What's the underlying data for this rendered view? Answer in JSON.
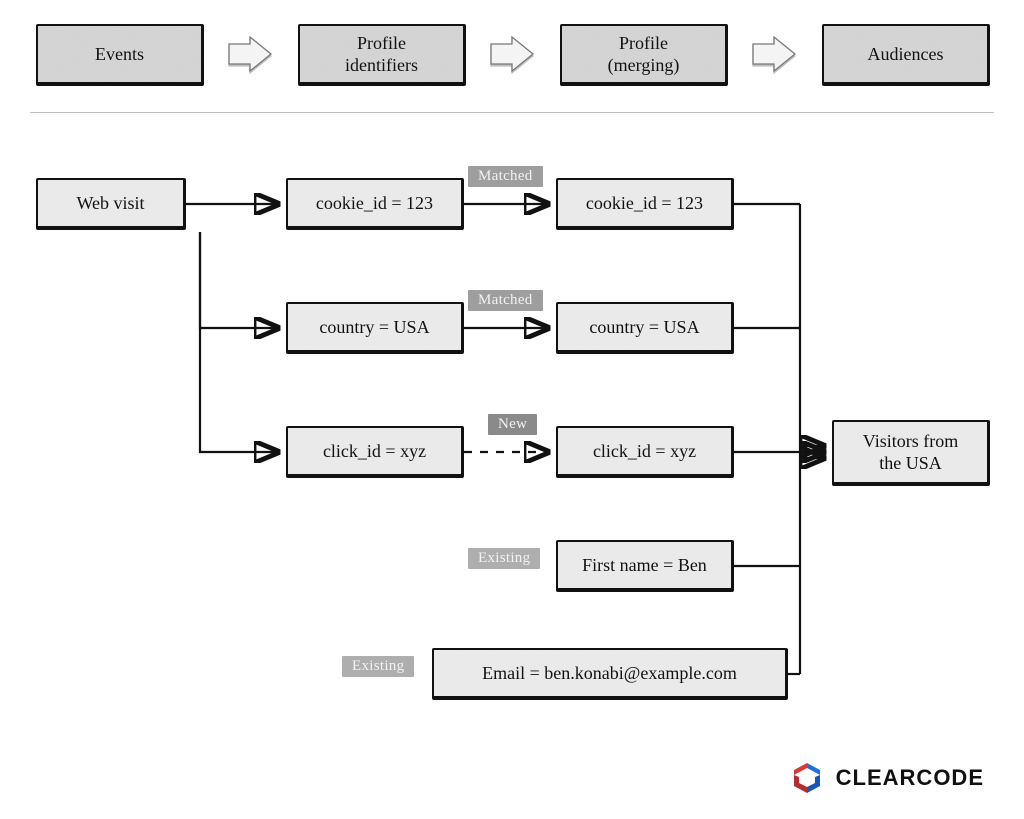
{
  "header": {
    "events": "Events",
    "identifiers": "Profile\nidentifiers",
    "merging": "Profile\n(merging)",
    "audiences": "Audiences"
  },
  "events": {
    "web_visit": "Web visit"
  },
  "identifiers": {
    "cookie": "cookie_id = 123",
    "country": "country = USA",
    "click": "click_id = xyz"
  },
  "merging": {
    "cookie": "cookie_id = 123",
    "country": "country = USA",
    "click": "click_id = xyz",
    "first_name": "First name = Ben",
    "email": "Email = ben.konabi@example.com"
  },
  "audiences": {
    "usa": "Visitors from\nthe USA"
  },
  "tags": {
    "matched": "Matched",
    "new": "New",
    "existing": "Existing"
  },
  "brand": "CLEARCODE"
}
